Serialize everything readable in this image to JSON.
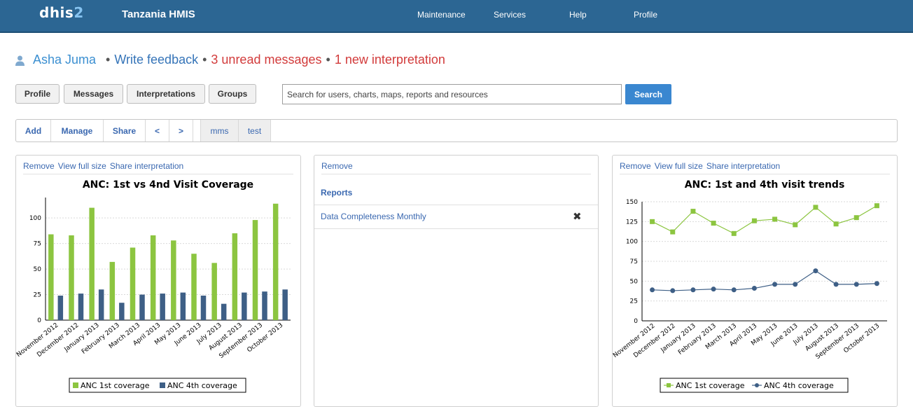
{
  "header": {
    "logo_main": "dhis",
    "logo_accent": "2",
    "app_title": "Tanzania HMIS",
    "menu": [
      "Maintenance",
      "Services",
      "Help",
      "Profile"
    ]
  },
  "user_bar": {
    "name": "Asha Juma",
    "sep": "•",
    "feedback": "Write feedback",
    "messages": "3 unread messages",
    "interpretations": "1 new interpretation"
  },
  "buttons": {
    "profile": "Profile",
    "messages": "Messages",
    "interpretations": "Interpretations",
    "groups": "Groups"
  },
  "search": {
    "placeholder": "Search for users, charts, maps, reports and resources",
    "button": "Search"
  },
  "toolbar": {
    "add": "Add",
    "manage": "Manage",
    "share": "Share",
    "prev": "<",
    "next": ">",
    "dash1": "mms",
    "dash2": "test"
  },
  "panels": {
    "left": {
      "remove": "Remove",
      "view": "View full size",
      "share": "Share interpretation"
    },
    "middle": {
      "remove": "Remove",
      "heading": "Reports",
      "item": "Data Completeness Monthly"
    },
    "right": {
      "remove": "Remove",
      "view": "View full size",
      "share": "Share interpretation"
    }
  },
  "colors": {
    "header": "#2c6693",
    "link": "#3a68b0",
    "alert": "#d23b3b",
    "series1": "#8cc540",
    "series2": "#3e5f86"
  },
  "chart_data": [
    {
      "type": "bar",
      "title": "ANC: 1st vs 4nd Visit Coverage",
      "categories": [
        "November 2012",
        "December 2012",
        "January 2013",
        "February 2013",
        "March 2013",
        "April 2013",
        "May 2013",
        "June 2013",
        "July 2013",
        "August 2013",
        "September 2013",
        "October 2013"
      ],
      "series": [
        {
          "name": "ANC 1st coverage",
          "values": [
            84,
            83,
            110,
            57,
            71,
            83,
            78,
            65,
            56,
            85,
            98,
            114
          ]
        },
        {
          "name": "ANC 4th coverage",
          "values": [
            24,
            26,
            30,
            17,
            25,
            26,
            27,
            24,
            16,
            27,
            28,
            30
          ]
        }
      ],
      "yticks": [
        0,
        25,
        50,
        75,
        100
      ],
      "ylim": [
        0,
        120
      ],
      "legend": "bottom",
      "grid": true
    },
    {
      "type": "line",
      "title": "ANC: 1st and 4th visit trends",
      "categories": [
        "November 2012",
        "December 2012",
        "January 2013",
        "February 2013",
        "March 2013",
        "April 2013",
        "May 2013",
        "June 2013",
        "July 2013",
        "August 2013",
        "September 2013",
        "October 2013"
      ],
      "series": [
        {
          "name": "ANC 1st coverage",
          "values": [
            125,
            112,
            138,
            123,
            110,
            126,
            128,
            121,
            143,
            122,
            130,
            145
          ]
        },
        {
          "name": "ANC 4th coverage",
          "values": [
            39,
            38,
            39,
            40,
            39,
            41,
            46,
            46,
            63,
            46,
            46,
            47
          ]
        }
      ],
      "yticks": [
        0,
        25,
        50,
        75,
        100,
        125,
        150
      ],
      "ylim": [
        0,
        150
      ],
      "legend": "bottom",
      "grid": true
    }
  ]
}
